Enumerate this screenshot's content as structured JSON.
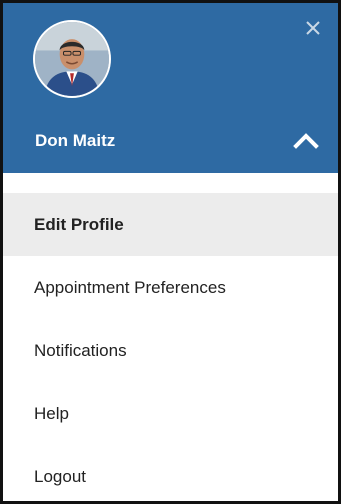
{
  "header": {
    "user_name": "Don Maitz",
    "avatar_icon": "user-avatar",
    "close_icon": "close-icon",
    "collapse_icon": "chevron-up-icon",
    "background_color": "#2e6aa3"
  },
  "menu": {
    "items": [
      {
        "label": "Edit Profile",
        "active": true
      },
      {
        "label": "Appointment Preferences",
        "active": false
      },
      {
        "label": "Notifications",
        "active": false
      },
      {
        "label": "Help",
        "active": false
      },
      {
        "label": "Logout",
        "active": false
      }
    ]
  }
}
